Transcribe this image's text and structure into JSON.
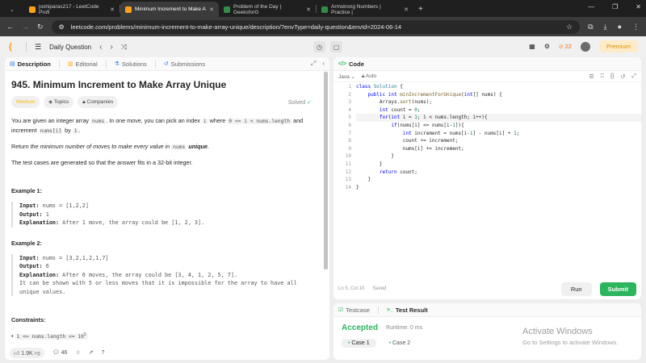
{
  "browser": {
    "tabs": [
      {
        "title": "joshiparas217 - LeetCode Profi",
        "color": "#ffa116",
        "active": false
      },
      {
        "title": "Minimum Increment to Make A",
        "color": "#ffa116",
        "active": true
      },
      {
        "title": "Problem of the Day | GeeksforG",
        "color": "#2f8d46",
        "active": false
      },
      {
        "title": "Armstrong Numbers | Practice |",
        "color": "#2f8d46",
        "active": false
      }
    ],
    "url": "leetcode.com/problems/minimum-increment-to-make-array-unique/description/?envType=daily-question&envId=2024-06-14",
    "win_min": "—",
    "win_max": "❐",
    "win_close": "✕"
  },
  "nav": {
    "daily_question": "Daily Question",
    "streak": "22",
    "premium": "Premium"
  },
  "left_tabs": [
    {
      "label": "Description",
      "icon": "▤",
      "color": "#2d7ff9"
    },
    {
      "label": "Editorial",
      "icon": "▥",
      "color": "#ffa116"
    },
    {
      "label": "Solutions",
      "icon": "⚗",
      "color": "#2d7ff9"
    },
    {
      "label": "Submissions",
      "icon": "↺",
      "color": "#2d7ff9"
    }
  ],
  "problem": {
    "title": "945. Minimum Increment to Make Array Unique",
    "solved": "Solved",
    "difficulty": "Medium",
    "topics": "Topics",
    "companies": "Companies",
    "p1a": "You are given an integer array",
    "p1_code1": "nums",
    "p1b": ". In one move, you can pick an index",
    "p1_code2": "i",
    "p1c": "where",
    "p1_code3": "0 <= i < nums.length",
    "p1d": "and increment",
    "p1_code4": "nums[i]",
    "p1e": "by",
    "p1_code5": "1",
    "p1f": ".",
    "p2a": "Return ",
    "p2_em": "the minimum number of moves to make every value in",
    "p2_code": "nums",
    "p2_strong": "unique",
    "p2b": ".",
    "p3": "The test cases are generated so that the answer fits in a 32-bit integer.",
    "examples": [
      {
        "heading": "Example 1:",
        "input_label": "Input:",
        "input": "nums = [1,2,2]",
        "output_label": "Output:",
        "output": "1",
        "expl_label": "Explanation:",
        "explanation": "After 1 move, the array could be [1, 2, 3].",
        "extra": ""
      },
      {
        "heading": "Example 2:",
        "input_label": "Input:",
        "input": "nums = [3,2,1,2,1,7]",
        "output_label": "Output:",
        "output": "6",
        "expl_label": "Explanation:",
        "explanation": "After 6 moves, the array could be [3, 4, 1, 2, 5, 7].",
        "extra": "It can be shown with 5 or less moves that it is impossible for the array to have all unique values."
      }
    ],
    "constraints_heading": "Constraints:",
    "constraint1": "1 <= nums.length <= 10",
    "constraint1_sup": "5"
  },
  "left_footer": {
    "likes": "1.9K",
    "comments": "46"
  },
  "code_panel": {
    "title": "Code",
    "language": "Java",
    "auto": "Auto",
    "status_pos": "Ln 5, Col 10",
    "status_saved": "Saved",
    "run": "Run",
    "submit": "Submit",
    "lines": [
      {
        "n": "1",
        "html": "<span class=\"kw\">class</span> <span class=\"ty\">Solution</span> {"
      },
      {
        "n": "2",
        "html": "    <span class=\"kw\">public</span> <span class=\"kw\">int</span> <span class=\"fn\">minIncrementForUnique</span>(<span class=\"kw\">int</span>[] nums) {"
      },
      {
        "n": "3",
        "html": "        Arrays.<span class=\"fn\">sort</span>(nums);"
      },
      {
        "n": "4",
        "html": "        <span class=\"kw\">int</span> count = <span class=\"nm\">0</span>;"
      },
      {
        "n": "5",
        "html": "        <span class=\"kw\">for</span>(<span class=\"kw\">int</span> i = <span class=\"nm\">1</span>; i &lt; nums.length; i++){"
      },
      {
        "n": "6",
        "html": "            <span class=\"kw\">if</span>(nums[i] &lt;= nums[i-<span class=\"nm\">1</span>]){"
      },
      {
        "n": "7",
        "html": "                <span class=\"kw\">int</span> increment = nums[i-<span class=\"nm\">1</span>] - nums[i] + <span class=\"nm\">1</span>;"
      },
      {
        "n": "8",
        "html": "                count += increment;"
      },
      {
        "n": "9",
        "html": "                nums[i] += increment;"
      },
      {
        "n": "10",
        "html": "            }"
      },
      {
        "n": "11",
        "html": "        }"
      },
      {
        "n": "12",
        "html": "        <span class=\"kw\">return</span> count;"
      },
      {
        "n": "13",
        "html": "    }"
      },
      {
        "n": "14",
        "html": "}"
      }
    ]
  },
  "test_panel": {
    "tab_testcase": "Testcase",
    "tab_result": "Test Result",
    "accepted": "Accepted",
    "runtime": "Runtime: 0 ms",
    "case1": "Case 1",
    "case2": "Case 2"
  },
  "watermark": {
    "title": "Activate Windows",
    "subtitle": "Go to Settings to activate Windows."
  }
}
